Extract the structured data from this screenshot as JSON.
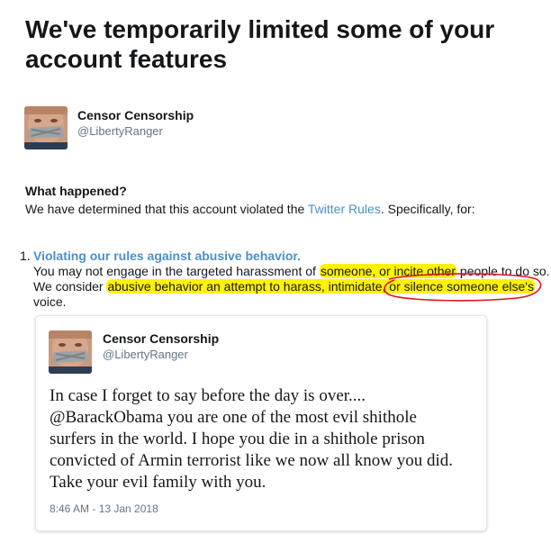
{
  "page": {
    "title": "We've temporarily limited some of your account features"
  },
  "account": {
    "name": "Censor Censorship",
    "handle": "@LibertyRanger"
  },
  "what_happened": {
    "heading": "What happened?",
    "text_before": "We have determined that this account violated the ",
    "link": "Twitter Rules",
    "text_after": ". Specifically, for:"
  },
  "violation": {
    "number": "1.",
    "title": "Violating our rules against abusive behavior.",
    "line1_a": "You may not engage in the targeted harassment of ",
    "line1_hl": "someone, or incite other",
    "line1_b": " people to do so.",
    "line2_a": "We consider ",
    "line2_hl": "abusive behavior an attempt to harass, intimidate, or silence someone else's",
    "line3": "voice."
  },
  "tweet": {
    "name": "Censor Censorship",
    "handle": "@LibertyRanger",
    "lines": [
      "In case I forget to say before the day is over....",
      "@BarackObama you are one of the most evil shithole",
      "surfers in the world. I hope you die in a shithole prison",
      "convicted of Armin terrorist like we now all know you did.",
      "Take your evil family with you."
    ],
    "timestamp": "8:46 AM - 13 Jan 2018"
  },
  "colors": {
    "link": "#4a90c8",
    "highlight": "#fff200",
    "annotation_circle": "#e0141e",
    "secondary_text": "#657786"
  }
}
